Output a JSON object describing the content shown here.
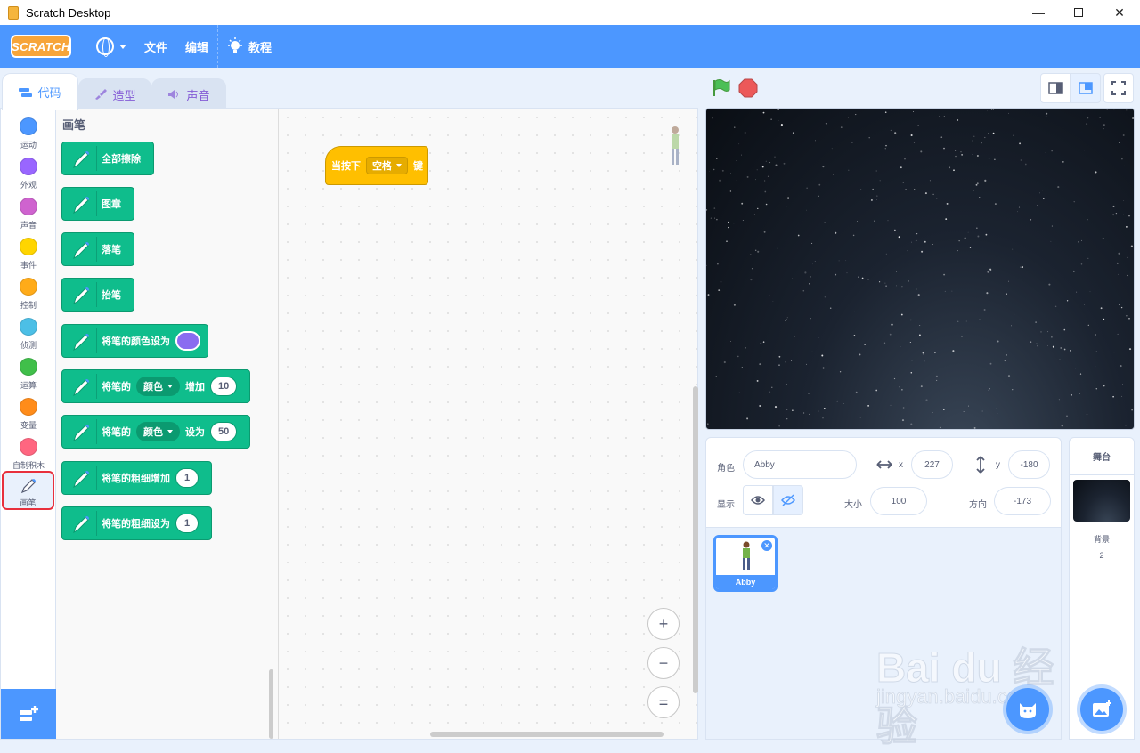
{
  "window": {
    "title": "Scratch Desktop"
  },
  "menubar": {
    "logo": "SCRATCH",
    "file": "文件",
    "edit": "编辑",
    "tutorials": "教程"
  },
  "tabs": {
    "code": "代码",
    "costumes": "造型",
    "sounds": "声音"
  },
  "categories": [
    {
      "label": "运动",
      "color": "#4c97ff"
    },
    {
      "label": "外观",
      "color": "#9966ff"
    },
    {
      "label": "声音",
      "color": "#cf63cf"
    },
    {
      "label": "事件",
      "color": "#ffd500"
    },
    {
      "label": "控制",
      "color": "#ffab19"
    },
    {
      "label": "侦测",
      "color": "#4cbfe6"
    },
    {
      "label": "运算",
      "color": "#40bf4a"
    },
    {
      "label": "变量",
      "color": "#ff8c1a"
    },
    {
      "label": "自制积木",
      "color": "#ff6680"
    },
    {
      "label": "画笔",
      "icon": "pen-icon",
      "selected": true
    }
  ],
  "palette": {
    "title": "画笔",
    "blocks": {
      "clear": "全部擦除",
      "stamp": "图章",
      "pen_down": "落笔",
      "pen_up": "抬笔",
      "set_color": "将笔的颜色设为",
      "change_param": {
        "pre": "将笔的",
        "dropdown": "颜色",
        "post": "增加",
        "value": "10"
      },
      "set_param": {
        "pre": "将笔的",
        "dropdown": "颜色",
        "post": "设为",
        "value": "50"
      },
      "change_size": {
        "text": "将笔的粗细增加",
        "value": "1"
      },
      "set_size": {
        "text": "将笔的粗细设为",
        "value": "1"
      }
    },
    "pen_color": "#8a6cf0"
  },
  "script": {
    "hat": {
      "pre": "当按下",
      "key": "空格",
      "post": "键"
    }
  },
  "zoom": {
    "in": "+",
    "out": "−",
    "reset": "="
  },
  "sprite_info": {
    "sprite_label": "角色",
    "sprite_name": "Abby",
    "x_label": "x",
    "x": "227",
    "y_label": "y",
    "y": "-180",
    "show_label": "显示",
    "size_label": "大小",
    "size": "100",
    "direction_label": "方向",
    "direction": "-173"
  },
  "sprites": [
    {
      "name": "Abby"
    }
  ],
  "stage_panel": {
    "title": "舞台",
    "backdrops_label": "背景",
    "backdrops_count": "2"
  },
  "watermark": {
    "logo": "Bai du 经验",
    "url": "jingyan.baidu.com"
  }
}
